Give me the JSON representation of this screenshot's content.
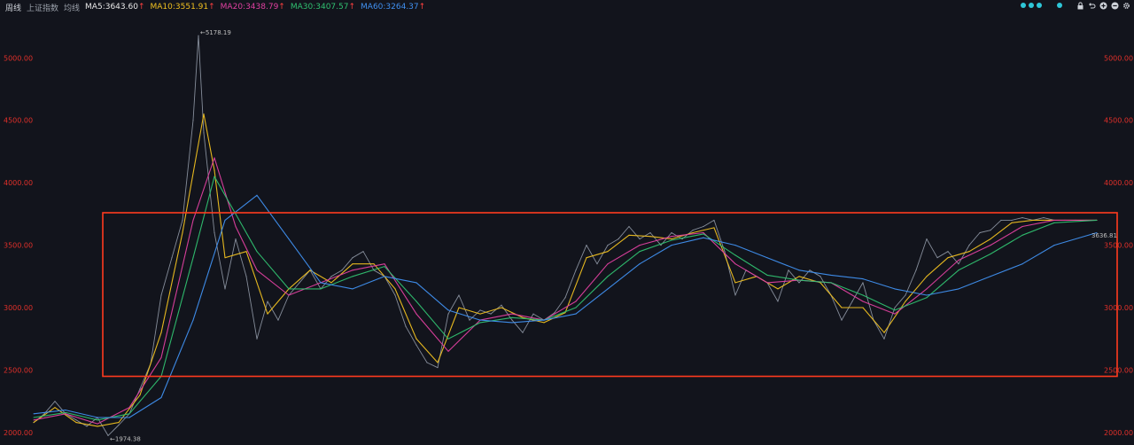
{
  "header": {
    "tabs": [
      {
        "label": "周线",
        "active": true
      },
      {
        "label": "上证指数",
        "active": false
      },
      {
        "label": "均线",
        "active": false
      }
    ],
    "indicators": [
      {
        "label": "MA5:3643.60",
        "arrow": "↑",
        "color": "#e8e8e8"
      },
      {
        "label": "MA10:3551.91",
        "arrow": "↑",
        "color": "#f0c020"
      },
      {
        "label": "MA20:3438.79",
        "arrow": "↑",
        "color": "#e040a0"
      },
      {
        "label": "MA30:3407.57",
        "arrow": "↑",
        "color": "#30c070"
      },
      {
        "label": "MA60:3264.37",
        "arrow": "↑",
        "color": "#4090f0"
      }
    ]
  },
  "toolbar": {
    "icons": [
      "lock-icon",
      "undo-icon",
      "add-icon",
      "minus-icon",
      "settings-icon"
    ]
  },
  "chart_data": {
    "type": "line",
    "title": "",
    "ylim": [
      1900,
      5350
    ],
    "y_ticks": [
      2000,
      2500,
      3000,
      3500,
      4000,
      4500,
      5000
    ],
    "y_tick_labels": [
      "2000.00",
      "2500.00",
      "3000.00",
      "3500.00",
      "4000.00",
      "4500.00",
      "5000.00"
    ],
    "x_range": [
      0,
      100
    ],
    "highlight_box": {
      "y_low": 2450,
      "y_high": 3760,
      "color": "#ff3b1f"
    },
    "annotations": [
      {
        "text": "5178.19",
        "x": 15.5,
        "y": 5178.19
      },
      {
        "text": "1974.38",
        "x": 7.0,
        "y": 1974.38
      }
    ],
    "current_price_label": "3636.81",
    "series": [
      {
        "color": "#9aa2b0",
        "x": [
          0,
          1,
          2,
          3,
          4,
          5,
          6,
          7,
          8,
          9,
          10,
          11,
          12,
          13,
          14,
          15,
          15.5,
          16,
          17,
          18,
          19,
          20,
          21,
          22,
          23,
          24,
          25,
          26,
          27,
          28,
          29,
          30,
          31,
          32,
          33,
          34,
          35,
          36,
          37,
          38,
          39,
          40,
          41,
          42,
          43,
          44,
          45,
          46,
          47,
          48,
          49,
          50,
          51,
          52,
          53,
          54,
          55,
          56,
          57,
          58,
          59,
          60,
          61,
          62,
          63,
          64,
          65,
          66,
          67,
          68,
          69,
          70,
          71,
          72,
          73,
          74,
          75,
          76,
          77,
          78,
          79,
          80,
          81,
          82,
          83,
          84,
          85,
          86,
          87,
          88,
          89,
          90,
          91,
          92,
          93,
          94,
          95,
          96,
          97,
          98,
          99,
          100
        ],
        "y": [
          2080,
          2150,
          2250,
          2150,
          2100,
          2050,
          2120,
          1975,
          2060,
          2150,
          2350,
          2550,
          3100,
          3400,
          3700,
          4500,
          5178,
          4400,
          3600,
          3150,
          3550,
          3250,
          2750,
          3050,
          2900,
          3100,
          3200,
          3300,
          3150,
          3250,
          3300,
          3400,
          3450,
          3300,
          3250,
          3100,
          2850,
          2700,
          2560,
          2520,
          2950,
          3100,
          2900,
          2980,
          2950,
          3020,
          2900,
          2800,
          2950,
          2900,
          2960,
          3080,
          3300,
          3500,
          3350,
          3500,
          3550,
          3650,
          3550,
          3600,
          3500,
          3600,
          3550,
          3620,
          3650,
          3700,
          3450,
          3100,
          3300,
          3250,
          3200,
          3050,
          3300,
          3200,
          3300,
          3250,
          3100,
          2900,
          3050,
          3200,
          2900,
          2750,
          3000,
          3100,
          3300,
          3550,
          3400,
          3450,
          3350,
          3500,
          3600,
          3620,
          3700,
          3700,
          3720,
          3700,
          3720,
          3700,
          3700,
          3700,
          3700,
          3700
        ]
      },
      {
        "color": "#f0c020",
        "x": [
          0,
          2,
          4,
          6,
          8,
          10,
          12,
          14,
          16,
          17,
          18,
          20,
          22,
          24,
          26,
          28,
          30,
          32,
          34,
          36,
          38,
          40,
          42,
          44,
          46,
          48,
          50,
          52,
          54,
          56,
          58,
          60,
          62,
          64,
          66,
          68,
          70,
          72,
          74,
          76,
          78,
          80,
          82,
          84,
          86,
          88,
          90,
          92,
          94,
          96,
          98,
          100
        ],
        "y": [
          2080,
          2200,
          2080,
          2050,
          2080,
          2300,
          2800,
          3600,
          4550,
          4100,
          3400,
          3450,
          2950,
          3150,
          3300,
          3200,
          3350,
          3350,
          3150,
          2750,
          2560,
          3000,
          2950,
          3000,
          2920,
          2880,
          2960,
          3400,
          3450,
          3580,
          3570,
          3550,
          3600,
          3640,
          3200,
          3250,
          3150,
          3250,
          3200,
          3000,
          3000,
          2800,
          3050,
          3250,
          3400,
          3450,
          3550,
          3680,
          3700,
          3700,
          3700,
          3700
        ]
      },
      {
        "color": "#e040a0",
        "x": [
          0,
          3,
          6,
          9,
          12,
          15,
          17,
          19,
          21,
          24,
          27,
          30,
          33,
          36,
          39,
          42,
          45,
          48,
          51,
          54,
          57,
          60,
          63,
          66,
          69,
          72,
          75,
          78,
          81,
          84,
          87,
          90,
          93,
          96,
          100
        ],
        "y": [
          2100,
          2150,
          2070,
          2200,
          2600,
          3700,
          4200,
          3650,
          3300,
          3100,
          3200,
          3300,
          3350,
          2950,
          2650,
          2900,
          2950,
          2900,
          3050,
          3350,
          3500,
          3570,
          3600,
          3350,
          3200,
          3220,
          3200,
          3050,
          2950,
          3150,
          3380,
          3500,
          3650,
          3700,
          3700
        ]
      },
      {
        "color": "#30c070",
        "x": [
          0,
          3,
          6,
          9,
          12,
          15,
          17,
          19,
          21,
          24,
          27,
          30,
          33,
          36,
          39,
          42,
          45,
          48,
          51,
          54,
          57,
          60,
          63,
          66,
          69,
          72,
          75,
          78,
          81,
          84,
          87,
          90,
          93,
          96,
          100
        ],
        "y": [
          2120,
          2160,
          2100,
          2150,
          2450,
          3400,
          4050,
          3750,
          3450,
          3150,
          3150,
          3250,
          3330,
          3050,
          2750,
          2880,
          2920,
          2900,
          3000,
          3250,
          3450,
          3540,
          3590,
          3420,
          3260,
          3220,
          3200,
          3100,
          2980,
          3080,
          3300,
          3430,
          3580,
          3680,
          3700
        ]
      },
      {
        "color": "#4090f0",
        "x": [
          0,
          3,
          6,
          9,
          12,
          15,
          18,
          21,
          24,
          27,
          30,
          33,
          36,
          39,
          42,
          45,
          48,
          51,
          54,
          57,
          60,
          63,
          66,
          69,
          72,
          75,
          78,
          81,
          84,
          87,
          90,
          93,
          96,
          100
        ],
        "y": [
          2150,
          2180,
          2120,
          2120,
          2280,
          2900,
          3700,
          3900,
          3550,
          3200,
          3150,
          3250,
          3200,
          2980,
          2900,
          2880,
          2900,
          2950,
          3150,
          3350,
          3500,
          3560,
          3500,
          3400,
          3300,
          3260,
          3230,
          3150,
          3100,
          3150,
          3250,
          3350,
          3500,
          3600
        ]
      }
    ]
  }
}
